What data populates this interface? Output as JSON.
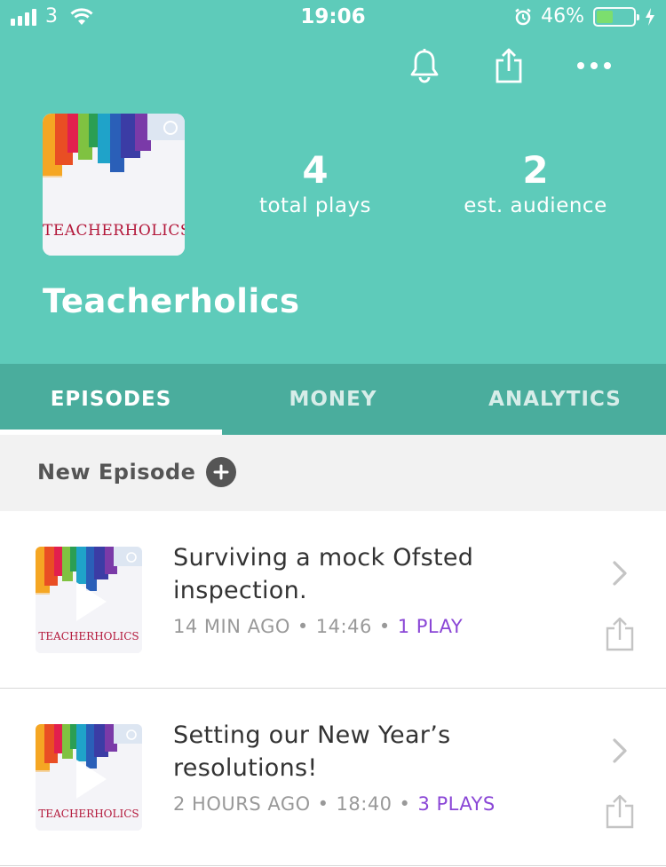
{
  "status_bar": {
    "carrier": "3",
    "time": "19:06",
    "battery": "46%",
    "battery_level": 0.46
  },
  "header": {
    "actions": [
      {
        "name": "notifications",
        "icon": "bell-icon"
      },
      {
        "name": "share",
        "icon": "share-icon"
      },
      {
        "name": "more",
        "icon": "more-dots-icon"
      }
    ],
    "cover_text": "TEACHERHOLICS",
    "stats": [
      {
        "value": "4",
        "label": "total plays"
      },
      {
        "value": "2",
        "label": "est. audience"
      }
    ],
    "podcast_title": "Teacherholics"
  },
  "tabs": [
    {
      "label": "EPISODES",
      "active": true
    },
    {
      "label": "MONEY",
      "active": false
    },
    {
      "label": "ANALYTICS",
      "active": false
    }
  ],
  "new_episode": {
    "label": "New Episode"
  },
  "episodes": [
    {
      "title": "Surviving a mock Ofsted inspection.",
      "ago": "14 MIN AGO",
      "duration": "14:46",
      "plays": "1 PLAY",
      "thumb_text": "TEACHERHOLICS"
    },
    {
      "title": "Setting our New Year’s resolutions!",
      "ago": "2 HOURS AGO",
      "duration": "18:40",
      "plays": "3 PLAYS",
      "thumb_text": "TEACHERHOLICS"
    }
  ],
  "colors": {
    "header_bg": "#5ecbba",
    "tabs_bg": "#4aad9d",
    "plays_accent": "#8a46d6",
    "cover_text": "#b3173a"
  }
}
